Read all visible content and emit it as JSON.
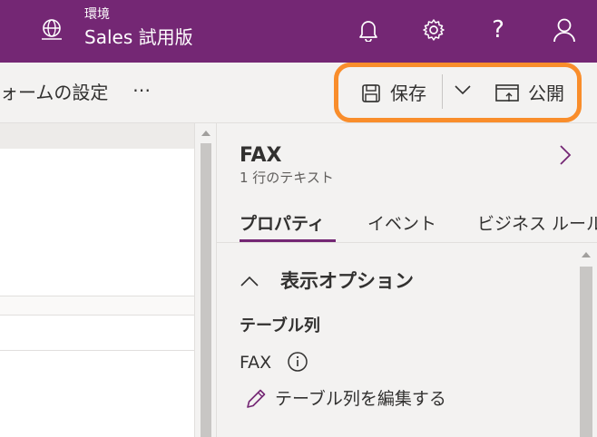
{
  "header": {
    "environment_label": "環境",
    "environment_name": "Sales 試用版",
    "icons": [
      "globe-icon",
      "bell-icon",
      "gear-icon",
      "help-icon",
      "person-icon"
    ],
    "help_glyph": "?"
  },
  "commandbar": {
    "form_title": "ォームの設定",
    "more": "⋯",
    "save_label": "保存",
    "publish_label": "公開"
  },
  "colors": {
    "brand": "#742774",
    "highlight": "#f98d2b"
  },
  "panel": {
    "field_name": "FAX",
    "field_type": "1 行のテキスト",
    "tabs": [
      {
        "label": "プロパティ",
        "active": true
      },
      {
        "label": "イベント",
        "active": false
      },
      {
        "label": "ビジネス ルール",
        "active": false
      }
    ],
    "section_title": "表示オプション",
    "table_column_label": "テーブル列",
    "table_column_value": "FAX",
    "edit_link": "テーブル列を編集する"
  }
}
